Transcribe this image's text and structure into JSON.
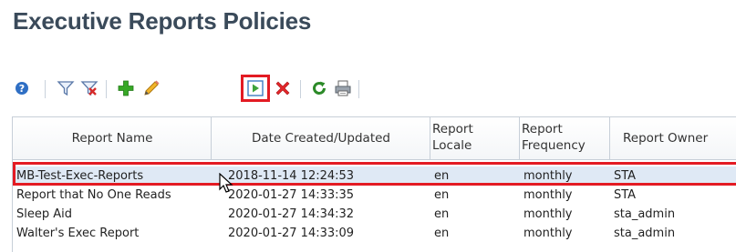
{
  "page": {
    "title": "Executive Reports Policies"
  },
  "toolbar": {
    "icons": [
      "help-icon",
      "filter-icon",
      "clear-filter-icon",
      "add-icon",
      "edit-icon",
      "run-icon",
      "delete-icon",
      "refresh-icon",
      "print-icon"
    ]
  },
  "table": {
    "columns": [
      "Report Name",
      "Date Created/Updated",
      "Report Locale",
      "Report Frequency",
      "Report Owner"
    ],
    "column_lines": {
      "locale": [
        "Report",
        "Locale"
      ],
      "frequency": [
        "Report",
        "Frequency"
      ]
    },
    "rows": [
      [
        "MB-Test-Exec-Reports",
        "2018-11-14 12:24:53",
        "en",
        "monthly",
        "STA"
      ],
      [
        "Report that No One Reads",
        "2020-01-27 14:33:35",
        "en",
        "monthly",
        "STA"
      ],
      [
        "Sleep Aid",
        "2020-01-27 14:34:32",
        "en",
        "monthly",
        "sta_admin"
      ],
      [
        "Walter's Exec Report",
        "2020-01-27 14:33:09",
        "en",
        "monthly",
        "sta_admin"
      ]
    ],
    "selected_row": 0
  },
  "colors": {
    "highlight": "#e31b23",
    "selected_row": "#dfe9f5",
    "title": "#3a4a5a"
  }
}
